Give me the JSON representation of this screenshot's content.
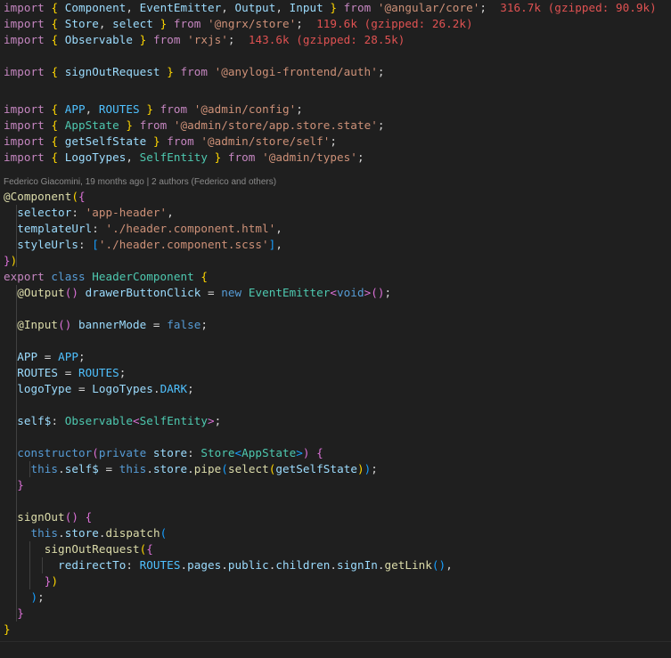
{
  "editor": {
    "lines": [
      {
        "tokens": [
          [
            "kw",
            "import"
          ],
          [
            "op",
            " "
          ],
          [
            "br1",
            "{"
          ],
          [
            "var",
            " Component"
          ],
          [
            "op",
            ", "
          ],
          [
            "var",
            "EventEmitter"
          ],
          [
            "op",
            ", "
          ],
          [
            "var",
            "Output"
          ],
          [
            "op",
            ", "
          ],
          [
            "var",
            "Input"
          ],
          [
            "op",
            " "
          ],
          [
            "br1",
            "}"
          ],
          [
            "kw",
            " from"
          ],
          [
            "op",
            " "
          ],
          [
            "st",
            "'@angular/core'"
          ],
          [
            "op",
            ";"
          ]
        ],
        "size": "316.7k (gzipped: 90.9k)"
      },
      {
        "tokens": [
          [
            "kw",
            "import"
          ],
          [
            "op",
            " "
          ],
          [
            "br1",
            "{"
          ],
          [
            "var",
            " Store"
          ],
          [
            "op",
            ", "
          ],
          [
            "var",
            "select"
          ],
          [
            "op",
            " "
          ],
          [
            "br1",
            "}"
          ],
          [
            "kw",
            " from"
          ],
          [
            "op",
            " "
          ],
          [
            "st",
            "'@ngrx/store'"
          ],
          [
            "op",
            ";"
          ]
        ],
        "size": "119.6k (gzipped: 26.2k)"
      },
      {
        "tokens": [
          [
            "kw",
            "import"
          ],
          [
            "op",
            " "
          ],
          [
            "br1",
            "{"
          ],
          [
            "var",
            " Observable"
          ],
          [
            "op",
            " "
          ],
          [
            "br1",
            "}"
          ],
          [
            "kw",
            " from"
          ],
          [
            "op",
            " "
          ],
          [
            "st",
            "'rxjs'"
          ],
          [
            "op",
            ";"
          ]
        ],
        "size": "143.6k (gzipped: 28.5k)"
      },
      {
        "tokens": []
      },
      {
        "tokens": [
          [
            "kw",
            "import"
          ],
          [
            "op",
            " "
          ],
          [
            "br1",
            "{"
          ],
          [
            "var",
            " signOutRequest"
          ],
          [
            "op",
            " "
          ],
          [
            "br1",
            "}"
          ],
          [
            "kw",
            " from"
          ],
          [
            "op",
            " "
          ],
          [
            "st",
            "'@anylogi-frontend/auth'"
          ],
          [
            "op",
            ";"
          ]
        ]
      },
      {
        "tokens": []
      },
      {
        "tokens": [
          [
            "kw",
            "import"
          ],
          [
            "op",
            " "
          ],
          [
            "br1",
            "{"
          ],
          [
            "cst",
            " APP"
          ],
          [
            "op",
            ", "
          ],
          [
            "cst",
            "ROUTES"
          ],
          [
            "op",
            " "
          ],
          [
            "br1",
            "}"
          ],
          [
            "kw",
            " from"
          ],
          [
            "op",
            " "
          ],
          [
            "st",
            "'@admin/config'"
          ],
          [
            "op",
            ";"
          ]
        ]
      },
      {
        "tokens": [
          [
            "kw",
            "import"
          ],
          [
            "op",
            " "
          ],
          [
            "br1",
            "{"
          ],
          [
            "ty",
            " AppState"
          ],
          [
            "op",
            " "
          ],
          [
            "br1",
            "}"
          ],
          [
            "kw",
            " from"
          ],
          [
            "op",
            " "
          ],
          [
            "st",
            "'@admin/store/app.store.state'"
          ],
          [
            "op",
            ";"
          ]
        ]
      },
      {
        "tokens": [
          [
            "kw",
            "import"
          ],
          [
            "op",
            " "
          ],
          [
            "br1",
            "{"
          ],
          [
            "var",
            " getSelfState"
          ],
          [
            "op",
            " "
          ],
          [
            "br1",
            "}"
          ],
          [
            "kw",
            " from"
          ],
          [
            "op",
            " "
          ],
          [
            "st",
            "'@admin/store/self'"
          ],
          [
            "op",
            ";"
          ]
        ]
      },
      {
        "tokens": [
          [
            "kw",
            "import"
          ],
          [
            "op",
            " "
          ],
          [
            "br1",
            "{"
          ],
          [
            "var",
            " LogoTypes"
          ],
          [
            "op",
            ", "
          ],
          [
            "ty",
            "SelfEntity"
          ],
          [
            "op",
            " "
          ],
          [
            "br1",
            "}"
          ],
          [
            "kw",
            " from"
          ],
          [
            "op",
            " "
          ],
          [
            "st",
            "'@admin/types'"
          ],
          [
            "op",
            ";"
          ]
        ]
      },
      {
        "tokens": []
      },
      {
        "blame": "Federico Giacomini, 19 months ago | 2 authors (Federico and others)"
      },
      {
        "tokens": [
          [
            "fn",
            "@Component"
          ],
          [
            "br1",
            "("
          ],
          [
            "br2",
            "{"
          ]
        ]
      },
      {
        "tokens": [
          [
            "var",
            "  selector"
          ],
          [
            "op",
            ": "
          ],
          [
            "st",
            "'app-header'"
          ],
          [
            "op",
            ","
          ]
        ]
      },
      {
        "tokens": [
          [
            "var",
            "  templateUrl"
          ],
          [
            "op",
            ": "
          ],
          [
            "st",
            "'./header.component.html'"
          ],
          [
            "op",
            ","
          ]
        ]
      },
      {
        "tokens": [
          [
            "var",
            "  styleUrls"
          ],
          [
            "op",
            ": "
          ],
          [
            "br3",
            "["
          ],
          [
            "st",
            "'./header.component.scss'"
          ],
          [
            "br3",
            "]"
          ],
          [
            "op",
            ","
          ]
        ]
      },
      {
        "tokens": [
          [
            "br2",
            "}"
          ],
          [
            "br1",
            ")"
          ]
        ]
      },
      {
        "tokens": [
          [
            "kw",
            "export"
          ],
          [
            "kb",
            " class"
          ],
          [
            "op",
            " "
          ],
          [
            "ty",
            "HeaderComponent"
          ],
          [
            "op",
            " "
          ],
          [
            "br1",
            "{"
          ]
        ]
      },
      {
        "tokens": [
          [
            "op",
            "  "
          ],
          [
            "fn",
            "@Output"
          ],
          [
            "br2",
            "()"
          ],
          [
            "var",
            " drawerButtonClick"
          ],
          [
            "op",
            " = "
          ],
          [
            "kb",
            "new"
          ],
          [
            "op",
            " "
          ],
          [
            "ty",
            "EventEmitter"
          ],
          [
            "br2",
            "<"
          ],
          [
            "kb",
            "void"
          ],
          [
            "br2",
            ">"
          ],
          [
            "br2",
            "()"
          ],
          [
            "op",
            ";"
          ]
        ]
      },
      {
        "tokens": []
      },
      {
        "tokens": [
          [
            "op",
            "  "
          ],
          [
            "fn",
            "@Input"
          ],
          [
            "br2",
            "()"
          ],
          [
            "var",
            " bannerMode"
          ],
          [
            "op",
            " = "
          ],
          [
            "kb",
            "false"
          ],
          [
            "op",
            ";"
          ]
        ]
      },
      {
        "tokens": []
      },
      {
        "tokens": [
          [
            "var",
            "  APP"
          ],
          [
            "op",
            " = "
          ],
          [
            "cst",
            "APP"
          ],
          [
            "op",
            ";"
          ]
        ]
      },
      {
        "tokens": [
          [
            "var",
            "  ROUTES"
          ],
          [
            "op",
            " = "
          ],
          [
            "cst",
            "ROUTES"
          ],
          [
            "op",
            ";"
          ]
        ]
      },
      {
        "tokens": [
          [
            "var",
            "  logoType"
          ],
          [
            "op",
            " = "
          ],
          [
            "var",
            "LogoTypes"
          ],
          [
            "op",
            "."
          ],
          [
            "cst",
            "DARK"
          ],
          [
            "op",
            ";"
          ]
        ]
      },
      {
        "tokens": []
      },
      {
        "tokens": [
          [
            "var",
            "  self$"
          ],
          [
            "op",
            ": "
          ],
          [
            "ty",
            "Observable"
          ],
          [
            "br2",
            "<"
          ],
          [
            "ty",
            "SelfEntity"
          ],
          [
            "br2",
            ">"
          ],
          [
            "op",
            ";"
          ]
        ]
      },
      {
        "tokens": []
      },
      {
        "tokens": [
          [
            "kb",
            "  constructor"
          ],
          [
            "br2",
            "("
          ],
          [
            "kb",
            "private"
          ],
          [
            "var",
            " store"
          ],
          [
            "op",
            ": "
          ],
          [
            "ty",
            "Store"
          ],
          [
            "br3",
            "<"
          ],
          [
            "ty",
            "AppState"
          ],
          [
            "br3",
            ">"
          ],
          [
            "br2",
            ")"
          ],
          [
            "op",
            " "
          ],
          [
            "br2",
            "{"
          ]
        ]
      },
      {
        "tokens": [
          [
            "kb",
            "    this"
          ],
          [
            "op",
            "."
          ],
          [
            "var",
            "self$"
          ],
          [
            "op",
            " = "
          ],
          [
            "kb",
            "this"
          ],
          [
            "op",
            "."
          ],
          [
            "var",
            "store"
          ],
          [
            "op",
            "."
          ],
          [
            "fn",
            "pipe"
          ],
          [
            "br3",
            "("
          ],
          [
            "fn",
            "select"
          ],
          [
            "br1",
            "("
          ],
          [
            "var",
            "getSelfState"
          ],
          [
            "br1",
            ")"
          ],
          [
            "br3",
            ")"
          ],
          [
            "op",
            ";"
          ]
        ]
      },
      {
        "tokens": [
          [
            "br2",
            "  }"
          ]
        ]
      },
      {
        "tokens": []
      },
      {
        "tokens": [
          [
            "fn",
            "  signOut"
          ],
          [
            "br2",
            "()"
          ],
          [
            "op",
            " "
          ],
          [
            "br2",
            "{"
          ]
        ]
      },
      {
        "tokens": [
          [
            "kb",
            "    this"
          ],
          [
            "op",
            "."
          ],
          [
            "var",
            "store"
          ],
          [
            "op",
            "."
          ],
          [
            "fn",
            "dispatch"
          ],
          [
            "br3",
            "("
          ]
        ]
      },
      {
        "tokens": [
          [
            "fn",
            "      signOutRequest"
          ],
          [
            "br1",
            "("
          ],
          [
            "br2",
            "{"
          ]
        ]
      },
      {
        "tokens": [
          [
            "var",
            "        redirectTo"
          ],
          [
            "op",
            ": "
          ],
          [
            "cst",
            "ROUTES"
          ],
          [
            "op",
            "."
          ],
          [
            "var",
            "pages"
          ],
          [
            "op",
            "."
          ],
          [
            "var",
            "public"
          ],
          [
            "op",
            "."
          ],
          [
            "var",
            "children"
          ],
          [
            "op",
            "."
          ],
          [
            "var",
            "signIn"
          ],
          [
            "op",
            "."
          ],
          [
            "fn",
            "getLink"
          ],
          [
            "br3",
            "()"
          ],
          [
            "op",
            ","
          ]
        ]
      },
      {
        "tokens": [
          [
            "br2",
            "      }"
          ],
          [
            "br1",
            ")"
          ]
        ]
      },
      {
        "tokens": [
          [
            "br3",
            "    )"
          ],
          [
            "op",
            ";"
          ]
        ]
      },
      {
        "tokens": [
          [
            "br2",
            "  }"
          ]
        ]
      },
      {
        "tokens": [
          [
            "br1",
            "}"
          ]
        ]
      }
    ]
  }
}
